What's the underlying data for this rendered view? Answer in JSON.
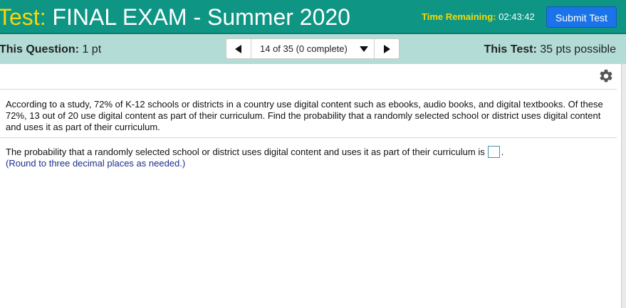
{
  "header": {
    "test_label": "Test:",
    "test_name": "FINAL EXAM - Summer 2020",
    "time_label": "Time Remaining:",
    "time_value": "02:43:42",
    "submit_label": "Submit Test"
  },
  "infobar": {
    "question_label": "This Question:",
    "question_points": "1 pt",
    "nav_status": "14 of 35 (0 complete)",
    "test_label": "This Test:",
    "test_points": "35 pts possible"
  },
  "question": {
    "text": "According to a study, 72% of K-12 schools or districts in a country use digital content such as ebooks, audio books, and digital textbooks. Of these 72%, 13 out of 20 use digital content as part of their curriculum. Find the probability that a randomly selected school or district uses digital content and uses it as part of their curriculum.",
    "answer_prefix": "The probability that a randomly selected school or district uses digital content and uses it as part of their curriculum is",
    "answer_suffix": ".",
    "hint": "(Round to three decimal places as needed.)"
  },
  "icons": {
    "gear": "gear-icon",
    "prev": "triangle-left-icon",
    "next": "triangle-right-icon",
    "dropdown": "triangle-down-icon"
  },
  "colors": {
    "header_bg": "#0e9584",
    "header_accent": "#f5d90a",
    "infobar_bg": "#b3dcd6",
    "submit_bg": "#1a73e8",
    "hint_text": "#1c2d8c"
  }
}
